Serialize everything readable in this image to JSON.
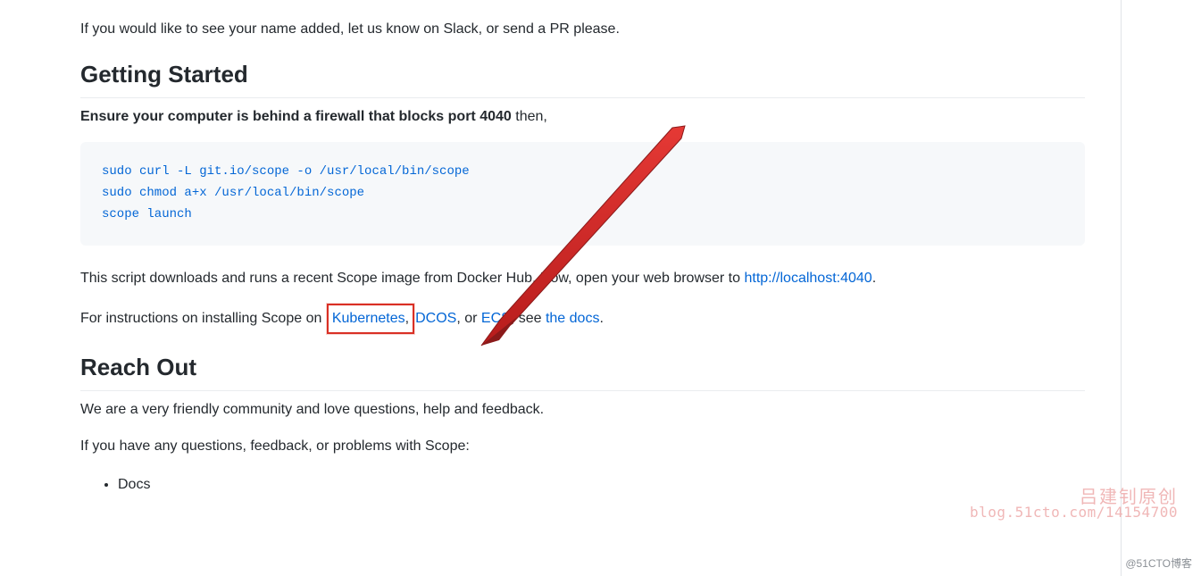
{
  "intro_para": "If you would like to see your name added, let us know on Slack, or send a PR please.",
  "sections": {
    "getting_started": {
      "title": "Getting Started",
      "firewall_bold": "Ensure your computer is behind a firewall that blocks port 4040",
      "firewall_then": " then,",
      "code_lines": [
        "sudo curl -L git.io/scope -o /usr/local/bin/scope",
        "sudo chmod a+x /usr/local/bin/scope",
        "scope launch"
      ],
      "after_code_pre": "This script downloads and runs a recent Scope image from Docker Hub. Now, open your web browser to ",
      "localhost_link": "http://localhost:4040",
      "after_code_post": ".",
      "instr_pre": "For instructions on installing Scope on ",
      "link_k8s": "Kubernetes",
      "comma1": ", ",
      "link_dcos": "DCOS",
      "comma2": ", or ",
      "link_ecs": "ECS",
      "see_pre": ", see ",
      "link_docs": "the docs",
      "period": "."
    },
    "reach_out": {
      "title": "Reach Out",
      "line1": "We are a very friendly community and love questions, help and feedback.",
      "line2": "If you have any questions, feedback, or problems with Scope:",
      "bullet1": "Docs"
    }
  },
  "watermark": {
    "line1": "吕建钊原创",
    "line2": "blog.51cto.com/14154700",
    "corner": "@51CTO博客"
  }
}
